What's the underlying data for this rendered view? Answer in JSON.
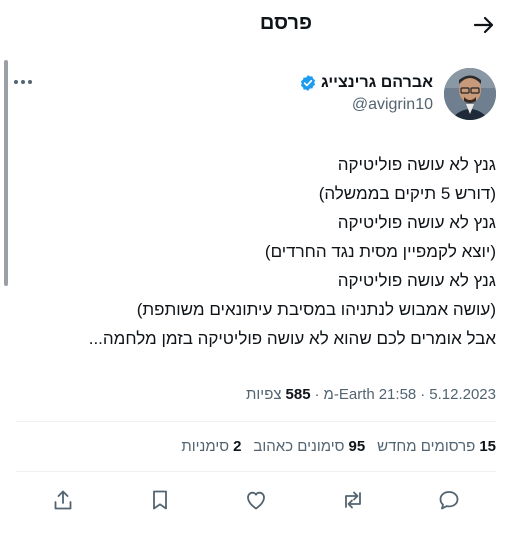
{
  "header": {
    "title": "פרסם"
  },
  "author": {
    "name": "אברהם גרינצייג",
    "handle": "@avigrin10"
  },
  "tweet": {
    "lines": [
      "גנץ לא עושה פוליטיקה",
      "(דורש 5 תיקים בממשלה)",
      "גנץ לא עושה פוליטיקה",
      "(יוצא לקמפיין מסית נגד החרדים)",
      "גנץ לא עושה פוליטיקה",
      "(עושה אמבוש לנתניהו במסיבת עיתונאים משותפת)",
      "אבל אומרים לכם שהוא לא עושה פוליטיקה בזמן מלחמה..."
    ],
    "date": "5.12.2023",
    "time": "21:58",
    "source": "Earth-מ",
    "views_count": "585",
    "views_label": "צפיות"
  },
  "stats": {
    "reposts_count": "15",
    "reposts_label": "פרסומים מחדש",
    "likes_count": "95",
    "likes_label": "סימונים כאהוב",
    "bookmarks_count": "2",
    "bookmarks_label": "סימניות"
  },
  "icons": {
    "back": "arrow-right-icon",
    "verified": "verified-badge-icon",
    "more": "more-icon",
    "reply": "reply-icon",
    "repost": "repost-icon",
    "like": "heart-icon",
    "bookmark": "bookmark-icon",
    "share": "share-icon"
  },
  "colors": {
    "verified": "#1d9bf0",
    "secondary_text": "#536471",
    "primary_text": "#0f1419"
  }
}
